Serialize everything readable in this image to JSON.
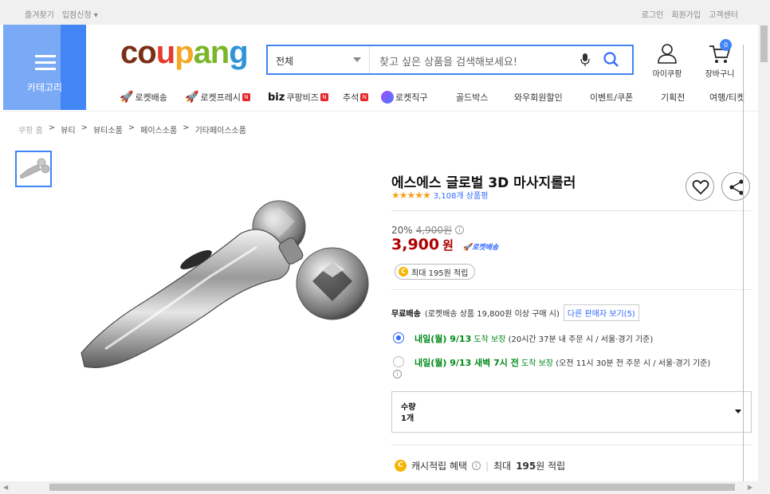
{
  "topbar": {
    "bookmark": "즐겨찾기",
    "seller_apply": "입점신청 ▾",
    "login": "로그인",
    "signup": "회원가입",
    "support": "고객센터"
  },
  "header": {
    "category_label": "카테고리",
    "logo": {
      "c1": "co",
      "c2": "u",
      "c3": "p",
      "c4": "an",
      "c5": "g"
    },
    "search": {
      "scope": "전체",
      "placeholder": "찾고 싶은 상품을 검색해보세요!"
    },
    "mycoupang": "마이쿠팡",
    "cart": "장바구니",
    "cart_count": "0"
  },
  "nav": {
    "rocket": "로켓배송",
    "rocket_fresh": "로켓프레시",
    "biz_logo": "biz",
    "biz": "쿠팡비즈",
    "chuseok": "추석",
    "global": "로켓직구",
    "goldbox": "골드박스",
    "wow": "와우회원할인",
    "event": "이벤트/쿠폰",
    "exhibition": "기획전",
    "travel": "여행/티켓",
    "new_badge": "N"
  },
  "breadcrumb": [
    "쿠팡 홈",
    "뷰티",
    "뷰티소품",
    "페이스소품",
    "기타페이스소품"
  ],
  "breadcrumb_sep": ">",
  "product": {
    "title": "에스에스 글로벌 3D 마사지롤러",
    "stars": "★★★★★",
    "review_count": "3,108개 상품평",
    "rating_value": 4.5,
    "discount_rate": "20%",
    "original_price": "4,900원",
    "price": "3,900",
    "price_unit": "원",
    "rocket_badge": "로켓배송",
    "cash_reward": "최대 195원 적립",
    "coin": "C",
    "info": "i"
  },
  "shipping": {
    "free": "무료배송",
    "condition": "(로켓배송 상품 19,800원 이상 구매 시)",
    "other_sellers": "다른 판매자 보기(5)",
    "options": [
      {
        "date": "내일(월) 9/13",
        "guarantee": "도착 보장",
        "note": "(20시간 37분 내 주문 시 / 서울⋅경기 기준)",
        "selected": true
      },
      {
        "date": "내일(월) 9/13 새벽 7시 전",
        "guarantee": "도착 보장",
        "note": "(오전 11시 30분 전 주문 시 / 서울⋅경기 기준)",
        "selected": false
      }
    ]
  },
  "quantity": {
    "label": "수량",
    "value": "1개"
  },
  "benefit": {
    "label": "캐시적립 혜택",
    "value_prefix": "최대",
    "amount": "195",
    "value_suffix": "원 적립"
  },
  "colors": {
    "brand_blue": "#346aff",
    "price_red": "#ae0000",
    "green": "#00891a"
  }
}
